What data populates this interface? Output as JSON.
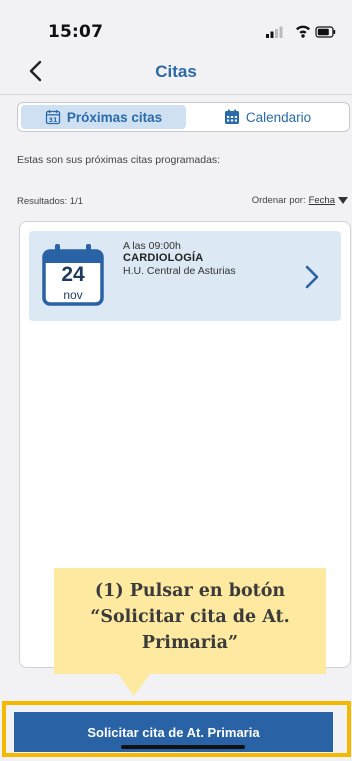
{
  "status_bar": {
    "time": "15:07",
    "icons": [
      "signal-icon",
      "wifi-icon",
      "battery-icon"
    ]
  },
  "nav": {
    "title": "Citas",
    "back_icon": "chevron-left-icon"
  },
  "tabs": [
    {
      "label": "Próximas citas",
      "icon": "calendar-day-icon",
      "active": true
    },
    {
      "label": "Calendario",
      "icon": "calendar-grid-icon",
      "active": false
    }
  ],
  "intro_text": "Estas son sus próximas citas programadas:",
  "results": {
    "label": "Resultados: 1/1"
  },
  "sort": {
    "label": "Ordenar por:",
    "value": "Fecha",
    "icon": "caret-down-icon"
  },
  "appointments": [
    {
      "day": "24",
      "month": "nov",
      "time": "A las 09:00h",
      "specialty": "CARDIOLOGÍA",
      "place": "H.U. Central de Asturias",
      "icon": "chevron-right-icon"
    }
  ],
  "callout": {
    "line1": "(1) Pulsar en botón",
    "line2": "“Solicitar cita de At.",
    "line3": "Primaria”"
  },
  "primary_button": {
    "label": "Solicitar cita de At. Primaria"
  },
  "colors": {
    "accent": "#2a6aa8",
    "button": "#2a62a6",
    "card": "#dce8f4",
    "callout": "#fde9a0",
    "highlight": "#f5b800"
  }
}
